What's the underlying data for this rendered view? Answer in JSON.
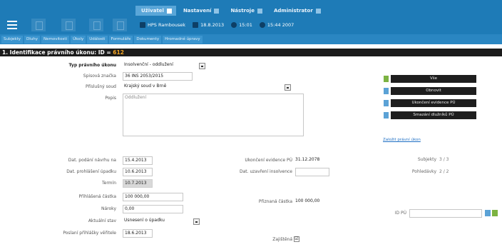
{
  "menu": {
    "tabs": [
      {
        "label": "Uživatel",
        "active": true
      },
      {
        "label": "Nastavení",
        "active": false
      },
      {
        "label": "Nástroje",
        "active": false
      },
      {
        "label": "Administrator",
        "active": false
      }
    ]
  },
  "status": {
    "user": "HPS Rambousek",
    "date": "18.8.2013",
    "time": "15:01",
    "session": "15:44 2007"
  },
  "nav": {
    "items": [
      "Subjekty",
      "Dluhy",
      "Nemovitosti",
      "Úkoly",
      "Události",
      "Formuláře",
      "Dokumenty",
      "Hromadné úpravy"
    ]
  },
  "title": {
    "text": "1. Identifikace právního úkonu: ID = ",
    "id": "612"
  },
  "form": {
    "typ_label": "Typ právního úkonu",
    "typ_value": "Insolvenční - oddlužení",
    "spisova_label": "Spisová značka",
    "spisova_value": "36 INS 2053/2015",
    "prislusny_label": "Příslušný soud",
    "prislusny_value": "Krajský soud v Brně",
    "popis_label": "Popis",
    "popis_value": "Oddlužení",
    "podani_label": "Dat. podání návrhu na",
    "podani_value": "15.4.2013",
    "prohlaseni_label": "Dat. prohlášení úpadku",
    "prohlaseni_value": "10.6.2013",
    "termin_label": "Termín",
    "termin_value": "10.7.2013",
    "prihlasena_label": "Přihlášená částka",
    "prihlasena_value": "100 000,00",
    "naroky_label": "Nároky",
    "naroky_value": "0,00",
    "aktualni_label": "Aktuální stav",
    "aktualni_value": "Usnesení o úpadku",
    "poslani_label": "Poslaní přihlášky věřitele",
    "poslani_value": "18.6.2013",
    "ukonceni_label": "Ukončení evidence PÚ",
    "ukonceni_value": "31.12.2078",
    "uzavreni_label": "Dat. uzavření insolvence",
    "uzavreni_value": "",
    "priznana_label": "Přiznaná částka",
    "priznana_value": "100 000,00",
    "zajistena_label": "Zajištěná",
    "zajistena_checked": "☑"
  },
  "actions": {
    "items": [
      "Vše",
      "Obnovit",
      "Ukončení evidence PÚ",
      "Smazání dlužníků PÚ"
    ],
    "link": "Založit právní úkon"
  },
  "summary": {
    "subjekty_label": "Subjekty",
    "subjekty_value": "3 / 3",
    "pohledavky_label": "Pohledávky",
    "pohledavky_value": "2 / 2",
    "idpu_label": "ID PÚ"
  }
}
